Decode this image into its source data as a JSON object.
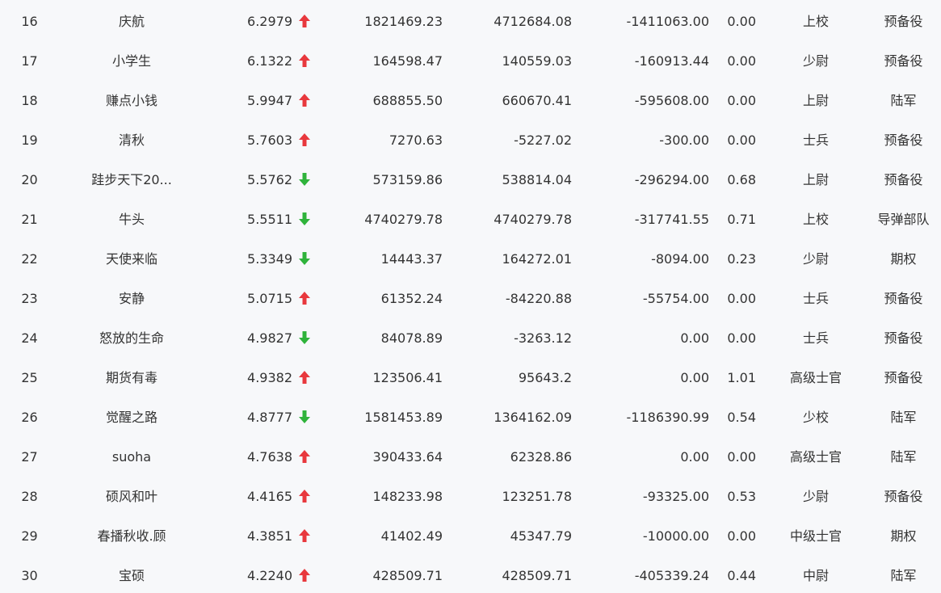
{
  "colors": {
    "up": "#e8383d",
    "down": "#2fb33b",
    "text": "#333333",
    "background": "#f7f8fa"
  },
  "rows": [
    {
      "rank": "16",
      "name": "庆航",
      "score": "6.2979",
      "trend": "up",
      "a": "1821469.23",
      "b": "4712684.08",
      "c": "-1411063.00",
      "d": "0.00",
      "title": "上校",
      "unit": "预备役"
    },
    {
      "rank": "17",
      "name": "小学生",
      "score": "6.1322",
      "trend": "up",
      "a": "164598.47",
      "b": "140559.03",
      "c": "-160913.44",
      "d": "0.00",
      "title": "少尉",
      "unit": "预备役"
    },
    {
      "rank": "18",
      "name": "赚点小钱",
      "score": "5.9947",
      "trend": "up",
      "a": "688855.50",
      "b": "660670.41",
      "c": "-595608.00",
      "d": "0.00",
      "title": "上尉",
      "unit": "陆军"
    },
    {
      "rank": "19",
      "name": "清秋",
      "score": "5.7603",
      "trend": "up",
      "a": "7270.63",
      "b": "-5227.02",
      "c": "-300.00",
      "d": "0.00",
      "title": "士兵",
      "unit": "预备役"
    },
    {
      "rank": "20",
      "name": "跬步天下20...",
      "score": "5.5762",
      "trend": "down",
      "a": "573159.86",
      "b": "538814.04",
      "c": "-296294.00",
      "d": "0.68",
      "title": "上尉",
      "unit": "预备役"
    },
    {
      "rank": "21",
      "name": "牛头",
      "score": "5.5511",
      "trend": "down",
      "a": "4740279.78",
      "b": "4740279.78",
      "c": "-317741.55",
      "d": "0.71",
      "title": "上校",
      "unit": "导弹部队"
    },
    {
      "rank": "22",
      "name": "天使来临",
      "score": "5.3349",
      "trend": "down",
      "a": "14443.37",
      "b": "164272.01",
      "c": "-8094.00",
      "d": "0.23",
      "title": "少尉",
      "unit": "期权"
    },
    {
      "rank": "23",
      "name": "安静",
      "score": "5.0715",
      "trend": "up",
      "a": "61352.24",
      "b": "-84220.88",
      "c": "-55754.00",
      "d": "0.00",
      "title": "士兵",
      "unit": "预备役"
    },
    {
      "rank": "24",
      "name": "怒放的生命",
      "score": "4.9827",
      "trend": "down",
      "a": "84078.89",
      "b": "-3263.12",
      "c": "0.00",
      "d": "0.00",
      "title": "士兵",
      "unit": "预备役"
    },
    {
      "rank": "25",
      "name": "期货有毒",
      "score": "4.9382",
      "trend": "up",
      "a": "123506.41",
      "b": "95643.2",
      "c": "0.00",
      "d": "1.01",
      "title": "高级士官",
      "unit": "预备役"
    },
    {
      "rank": "26",
      "name": "觉醒之路",
      "score": "4.8777",
      "trend": "down",
      "a": "1581453.89",
      "b": "1364162.09",
      "c": "-1186390.99",
      "d": "0.54",
      "title": "少校",
      "unit": "陆军"
    },
    {
      "rank": "27",
      "name": "suoha",
      "score": "4.7638",
      "trend": "up",
      "a": "390433.64",
      "b": "62328.86",
      "c": "0.00",
      "d": "0.00",
      "title": "高级士官",
      "unit": "陆军"
    },
    {
      "rank": "28",
      "name": "硕风和叶",
      "score": "4.4165",
      "trend": "up",
      "a": "148233.98",
      "b": "123251.78",
      "c": "-93325.00",
      "d": "0.53",
      "title": "少尉",
      "unit": "预备役"
    },
    {
      "rank": "29",
      "name": "春播秋收.顾",
      "score": "4.3851",
      "trend": "up",
      "a": "41402.49",
      "b": "45347.79",
      "c": "-10000.00",
      "d": "0.00",
      "title": "中级士官",
      "unit": "期权"
    },
    {
      "rank": "30",
      "name": "宝硕",
      "score": "4.2240",
      "trend": "up",
      "a": "428509.71",
      "b": "428509.71",
      "c": "-405339.24",
      "d": "0.44",
      "title": "中尉",
      "unit": "陆军"
    }
  ]
}
